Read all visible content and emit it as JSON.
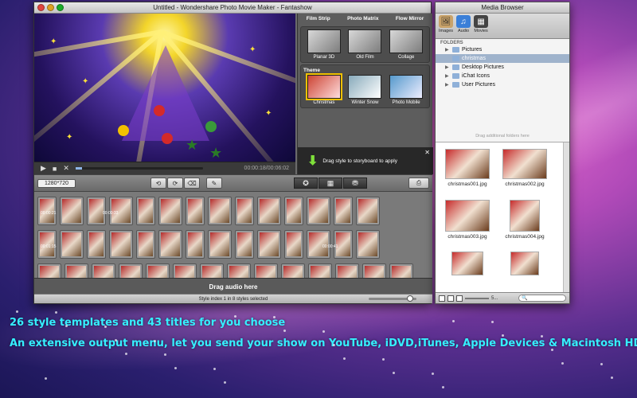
{
  "main_window": {
    "title": "Untitled - Wondershare Photo Movie Maker - Fantashow",
    "transport": {
      "play": "▶",
      "stop": "■",
      "shuffle": "✕",
      "time": "00:00:18/00:06:02",
      "progress": 0.05
    },
    "style_panel": {
      "tabs": [
        "Film Strip",
        "Photo Matrix",
        "Flow Mirror"
      ],
      "top_styles": [
        "Planar 3D",
        "Old Film",
        "Collage"
      ],
      "theme_label": "Theme",
      "themes": [
        "Christmas",
        "Winter Snow",
        "Photo Mobile"
      ],
      "drag_hint": "Drag style to storyboard to apply",
      "close": "✕"
    },
    "toolbar": {
      "resolution": "1280*720"
    },
    "storyboard": {
      "times": [
        "00:00:21",
        "00:00:33",
        "00:01:15",
        "00:00:41"
      ]
    },
    "audio_hint": "Drag audio here",
    "status": "Style index 1 in 8 styles selected"
  },
  "media_browser": {
    "title": "Media Browser",
    "tools": [
      "Images",
      "Audio",
      "Movies"
    ],
    "folders_header": "FOLDERS",
    "folders": [
      "Pictures",
      "christmas",
      "Desktop Pictures",
      "iChat Icons",
      "User Pictures"
    ],
    "folders_hint": "Drag additional folders here",
    "files": [
      "christmas001.jpg",
      "christmas002.jpg",
      "christmas003.jpg",
      "christmas004.jpg",
      "",
      ""
    ],
    "count": "5..."
  },
  "captions": [
    "26 style templates and 43 titles for you choose",
    "An  extensive output menu, let you send your show on YouTube, iDVD,iTunes, Apple Devices & Macintosh HD"
  ]
}
